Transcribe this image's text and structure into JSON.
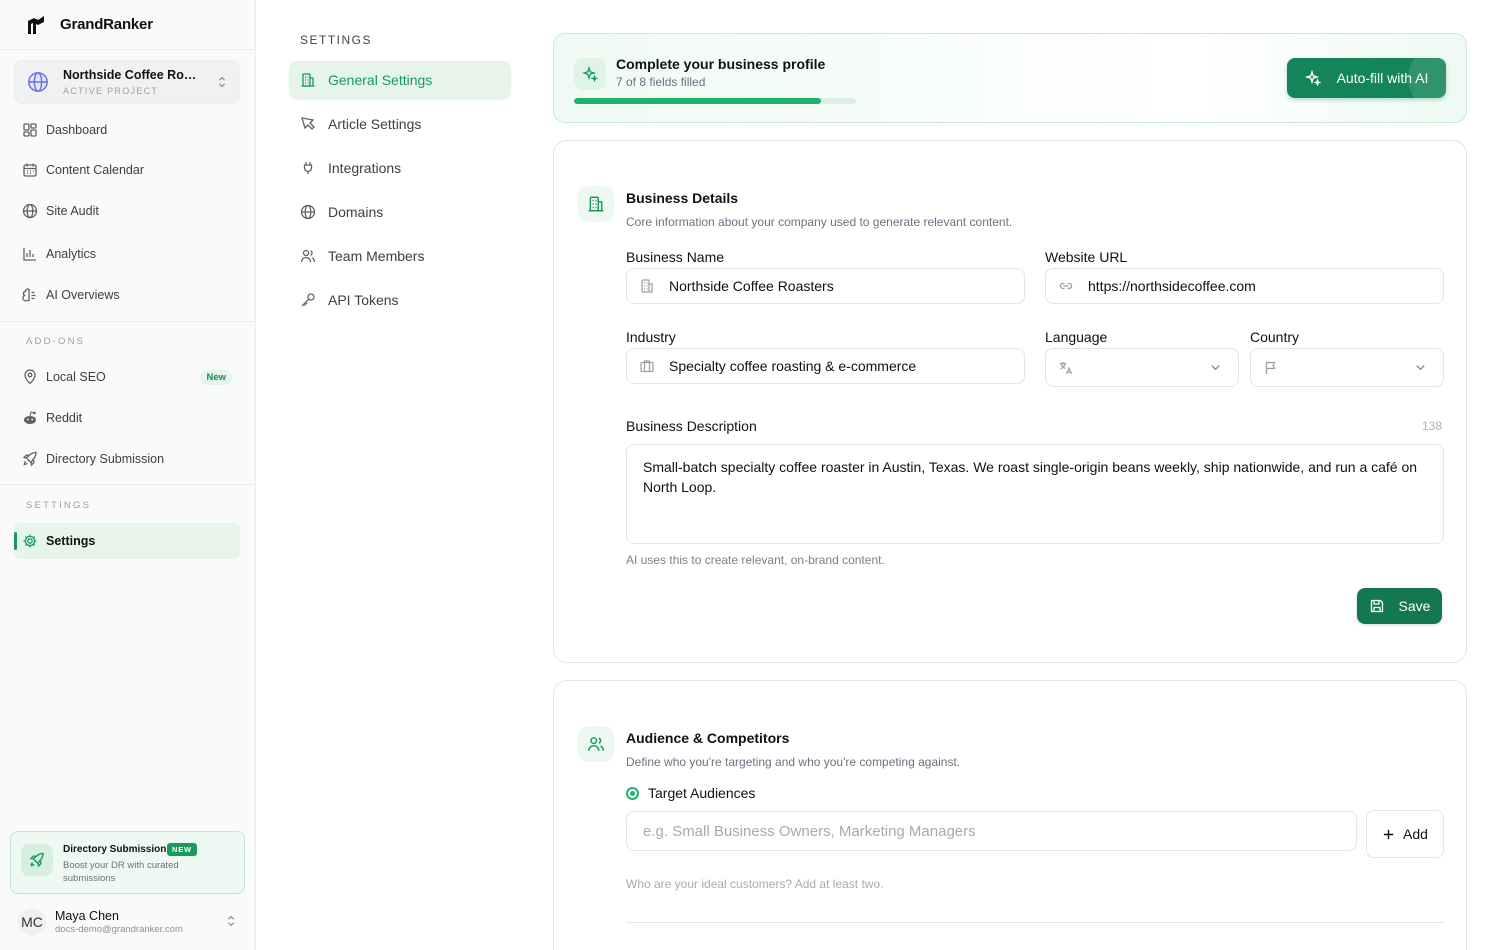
{
  "brand": {
    "name": "GrandRanker"
  },
  "project": {
    "name": "Northside Coffee Roasters",
    "label": "ACTIVE PROJECT"
  },
  "nav": {
    "main": [
      {
        "label": "Dashboard",
        "icon": "dashboard-icon"
      },
      {
        "label": "Content Calendar",
        "icon": "calendar-icon"
      },
      {
        "label": "Site Audit",
        "icon": "globe-icon"
      },
      {
        "label": "Analytics",
        "icon": "bar-chart-icon"
      },
      {
        "label": "AI Overviews",
        "icon": "brain-icon"
      }
    ],
    "addons_label": "ADD-ONS",
    "addons": [
      {
        "label": "Local SEO",
        "badge": "New",
        "icon": "map-pin-icon"
      },
      {
        "label": "Reddit",
        "icon": "reddit-icon"
      },
      {
        "label": "Directory Submission",
        "icon": "rocket-icon"
      }
    ],
    "settings_label": "SETTINGS",
    "settings": [
      {
        "label": "Settings",
        "icon": "gear-icon"
      }
    ]
  },
  "promo": {
    "title": "Directory Submission",
    "badge": "NEW",
    "description": "Boost your DR with curated submissions"
  },
  "user": {
    "initials": "MC",
    "name": "Maya Chen",
    "email": "docs-demo@grandranker.com"
  },
  "submenu": {
    "label": "SETTINGS",
    "items": [
      {
        "label": "General Settings",
        "icon": "building-icon"
      },
      {
        "label": "Article Settings",
        "icon": "pen-icon"
      },
      {
        "label": "Integrations",
        "icon": "plug-icon"
      },
      {
        "label": "Domains",
        "icon": "globe-icon"
      },
      {
        "label": "Team Members",
        "icon": "users-icon"
      },
      {
        "label": "API Tokens",
        "icon": "key-icon"
      }
    ]
  },
  "profile": {
    "title": "Complete your business profile",
    "status": "7 of 8 fields filled",
    "progress_filled": 7,
    "progress_total": 8,
    "autofill_label": "Auto-fill with AI"
  },
  "business": {
    "title": "Business Details",
    "description": "Core information about your company used to generate relevant content.",
    "name_label": "Business Name",
    "name_value": "Northside Coffee Roasters",
    "url_label": "Website URL",
    "url_value": "https://northsidecoffee.com",
    "industry_label": "Industry",
    "industry_value": "Specialty coffee roasting & e-commerce",
    "language_label": "Language",
    "country_label": "Country",
    "desc_label": "Business Description",
    "desc_count": "138",
    "desc_value": "Small-batch specialty coffee roaster in Austin, Texas. We roast single-origin beans weekly, ship nationwide, and run a café on North Loop.",
    "desc_hint": "AI uses this to create relevant, on-brand content.",
    "save_label": "Save"
  },
  "audience": {
    "title": "Audience & Competitors",
    "description": "Define who you're targeting and who you're competing against.",
    "target_label": "Target Audiences",
    "target_placeholder": "e.g. Small Business Owners, Marketing Managers",
    "add_label": "Add",
    "target_hint": "Who are your ideal customers? Add at least two."
  },
  "colors": {
    "accent": "#1a9a5c",
    "accent_dark": "#13784f"
  }
}
